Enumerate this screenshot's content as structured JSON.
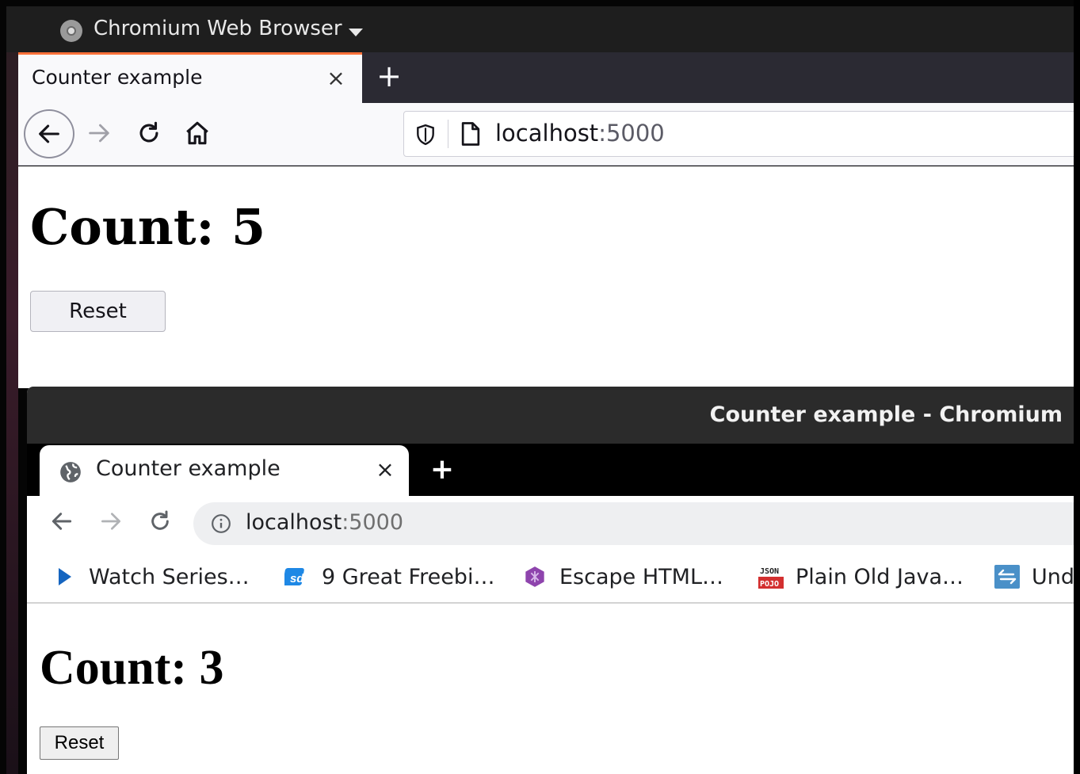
{
  "desktop": {
    "app_name": "Chromium Web Browser"
  },
  "firefox": {
    "tab_title": "Counter example",
    "tab_close": "×",
    "new_tab": "+",
    "url_host": "localhost",
    "url_port": ":5000",
    "count_text": "Count: 5",
    "reset_label": "Reset"
  },
  "chromium": {
    "window_title": "Counter example - Chromium",
    "tab_title": "Counter example",
    "tab_close": "×",
    "new_tab": "+",
    "url_host": "localhost",
    "url_port": ":5000",
    "bookmarks": [
      {
        "label": "Watch Series…",
        "icon": "play-icon",
        "color": "#1565c0"
      },
      {
        "label": "9 Great Freebi…",
        "icon": "sd-logo-icon",
        "color": "#1e88e5"
      },
      {
        "label": "Escape HTML…",
        "icon": "hexagon-icon",
        "color": "#8e44ad"
      },
      {
        "label": "Plain Old Java…",
        "icon": "json-pojo-icon",
        "color": "#d32f2f"
      },
      {
        "label": "Und",
        "icon": "arrows-icon",
        "color": "#1976d2"
      }
    ],
    "count_text": "Count: 3",
    "reset_label": "Reset"
  },
  "colors": {
    "firefox_accent": "#ff7139",
    "firefox_tabstrip": "#2b2a33",
    "chromium_titlebar": "#2b2b2b"
  }
}
